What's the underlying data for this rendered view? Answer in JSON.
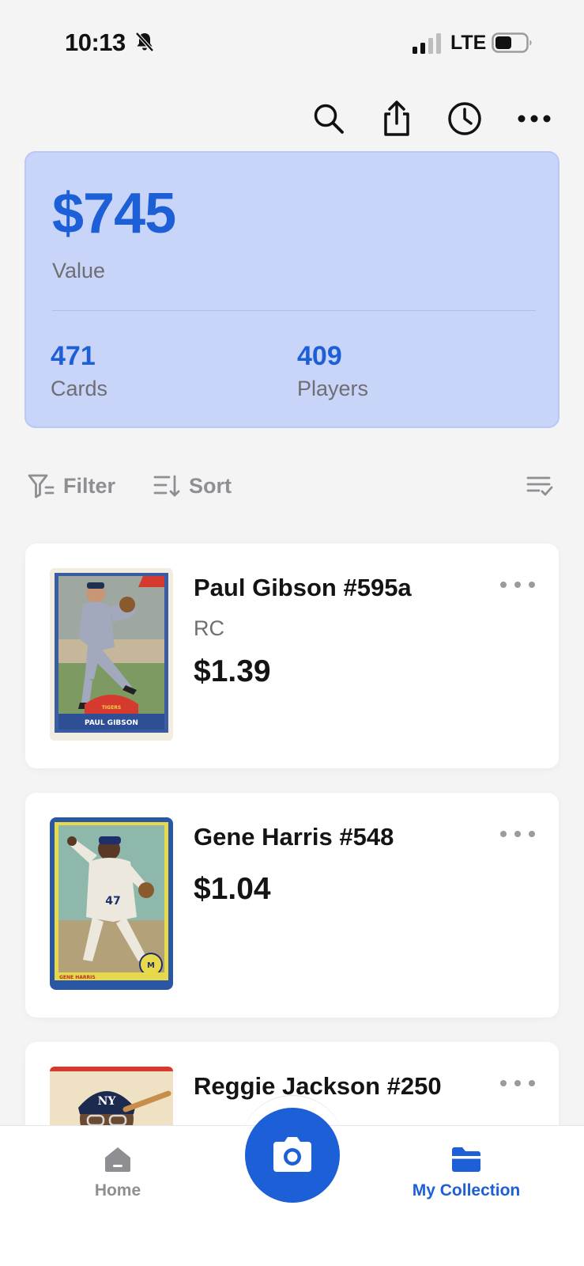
{
  "status_bar": {
    "time": "10:13",
    "network": "LTE"
  },
  "top_actions": [
    "search-icon",
    "share-icon",
    "history-icon",
    "more-icon"
  ],
  "summary": {
    "value": "$745",
    "value_label": "Value",
    "cards_count": "471",
    "cards_label": "Cards",
    "players_count": "409",
    "players_label": "Players"
  },
  "toolbar": {
    "filter_label": "Filter",
    "sort_label": "Sort"
  },
  "cards": [
    {
      "title": "Paul Gibson #595a",
      "subtitle": "RC",
      "price": "$1.39",
      "card_text": "PAUL GIBSON",
      "team_text": "TIGERS"
    },
    {
      "title": "Gene Harris #548",
      "subtitle": "",
      "price": "$1.04",
      "card_text": "GENE HARRIS"
    },
    {
      "title": "Reggie Jackson #250",
      "subtitle": "",
      "price": ""
    }
  ],
  "tab_bar": {
    "home_label": "Home",
    "collection_label": "My Collection"
  },
  "colors": {
    "accent": "#1c5fd6",
    "summary_bg": "#c8d4f8",
    "muted": "#8e8e93",
    "background": "#f4f4f4"
  }
}
